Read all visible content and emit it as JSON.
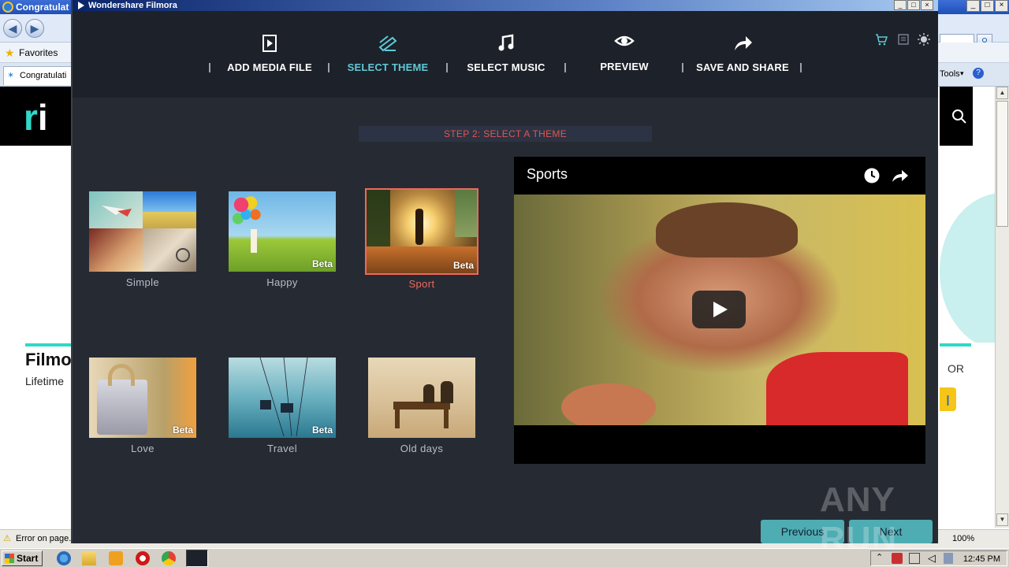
{
  "ie": {
    "title": "Congratulat",
    "favorites_label": "Favorites",
    "tab_label": "Congratulati",
    "tools_label": "Tools",
    "zoom": "100%",
    "status_text": "Error on page.",
    "site_text_filmo": "Filmo",
    "site_text_lifetime": "Lifetime",
    "site_text_or": "OR"
  },
  "filmora": {
    "window_title": "Wondershare Filmora",
    "steps": [
      {
        "label": "ADD MEDIA FILE",
        "icon": "media-file-icon"
      },
      {
        "label": "SELECT THEME",
        "icon": "theme-icon",
        "active": true
      },
      {
        "label": "SELECT MUSIC",
        "icon": "music-icon"
      },
      {
        "label": "PREVIEW",
        "icon": "eye-icon"
      },
      {
        "label": "SAVE AND SHARE",
        "icon": "share-arrow-icon"
      }
    ],
    "header_icons": [
      "cart-icon",
      "menu-icon",
      "brightness-icon"
    ],
    "step_banner": "STEP 2: SELECT A THEME",
    "themes": [
      {
        "name": "Simple",
        "beta": ""
      },
      {
        "name": "Happy",
        "beta": "Beta"
      },
      {
        "name": "Sport",
        "beta": "Beta",
        "selected": true
      },
      {
        "name": "Love",
        "beta": "Beta"
      },
      {
        "name": "Travel",
        "beta": "Beta"
      },
      {
        "name": "Old days",
        "beta": ""
      }
    ],
    "preview": {
      "title": "Sports"
    },
    "buttons": {
      "previous": "Previous",
      "next": "Next"
    },
    "colors": {
      "accent_teal": "#5fc9d6",
      "selected_red": "#f0685d",
      "button_teal": "#4eacb3",
      "background": "#262b33"
    }
  },
  "taskbar": {
    "start_label": "Start",
    "clock": "12:45 PM"
  },
  "watermark": "ANY RUN"
}
